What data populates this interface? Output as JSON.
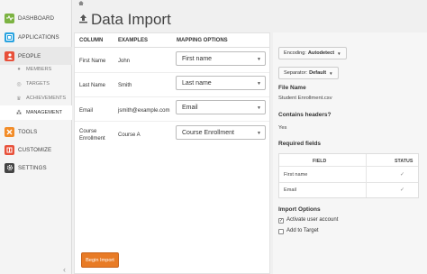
{
  "sidebar": {
    "items": [
      {
        "label": "DASHBOARD",
        "icon": "activity-icon",
        "color": "#7cb342"
      },
      {
        "label": "APPLICATIONS",
        "icon": "apps-icon",
        "color": "#29a3e0"
      },
      {
        "label": "PEOPLE",
        "icon": "people-icon",
        "color": "#e8503a"
      },
      {
        "label": "TOOLS",
        "icon": "tools-icon",
        "color": "#f28c28"
      },
      {
        "label": "CUSTOMIZE",
        "icon": "customize-icon",
        "color": "#e8503a"
      },
      {
        "label": "SETTINGS",
        "icon": "gear-icon",
        "color": "#444444"
      }
    ],
    "people_sub": [
      {
        "label": "MEMBERS",
        "icon": "user-icon"
      },
      {
        "label": "TARGETS",
        "icon": "target-icon"
      },
      {
        "label": "ACHIEVEMENTS",
        "icon": "trophy-icon"
      },
      {
        "label": "MANAGEMENT",
        "icon": "management-icon"
      }
    ],
    "active_sub": "MANAGEMENT"
  },
  "header": {
    "title": "Data Import"
  },
  "mapping": {
    "columns": [
      "COLUMN",
      "EXAMPLES",
      "MAPPING OPTIONS"
    ],
    "rows": [
      {
        "column": "First Name",
        "example": "John",
        "mapping": "First name"
      },
      {
        "column": "Last Name",
        "example": "Smith",
        "mapping": "Last name"
      },
      {
        "column": "Email",
        "example": "jsmith@example.com",
        "mapping": "Email"
      },
      {
        "column": "Course Enrollment",
        "example": "Course A",
        "mapping": "Course Enrollment"
      }
    ],
    "begin_button": "Begin Import"
  },
  "settings": {
    "encoding_label": "Encoding:",
    "encoding_value": "Autodetect",
    "separator_label": "Separator:",
    "separator_value": "Default",
    "file_name_label": "File Name",
    "file_name": "Student Enrollment.csv",
    "headers_label": "Contains headers?",
    "headers_value": "Yes",
    "required_label": "Required fields",
    "required_columns": [
      "FIELD",
      "STATUS"
    ],
    "required_rows": [
      {
        "field": "First name",
        "status": "✓"
      },
      {
        "field": "Email",
        "status": "✓"
      }
    ],
    "import_options_label": "Import Options",
    "options": [
      {
        "label": "Activate user account",
        "checked": true
      },
      {
        "label": "Add to Target",
        "checked": false
      }
    ]
  },
  "colors": {
    "accent": "#e87b26",
    "sidebar_bg": "#f4f4f4"
  }
}
